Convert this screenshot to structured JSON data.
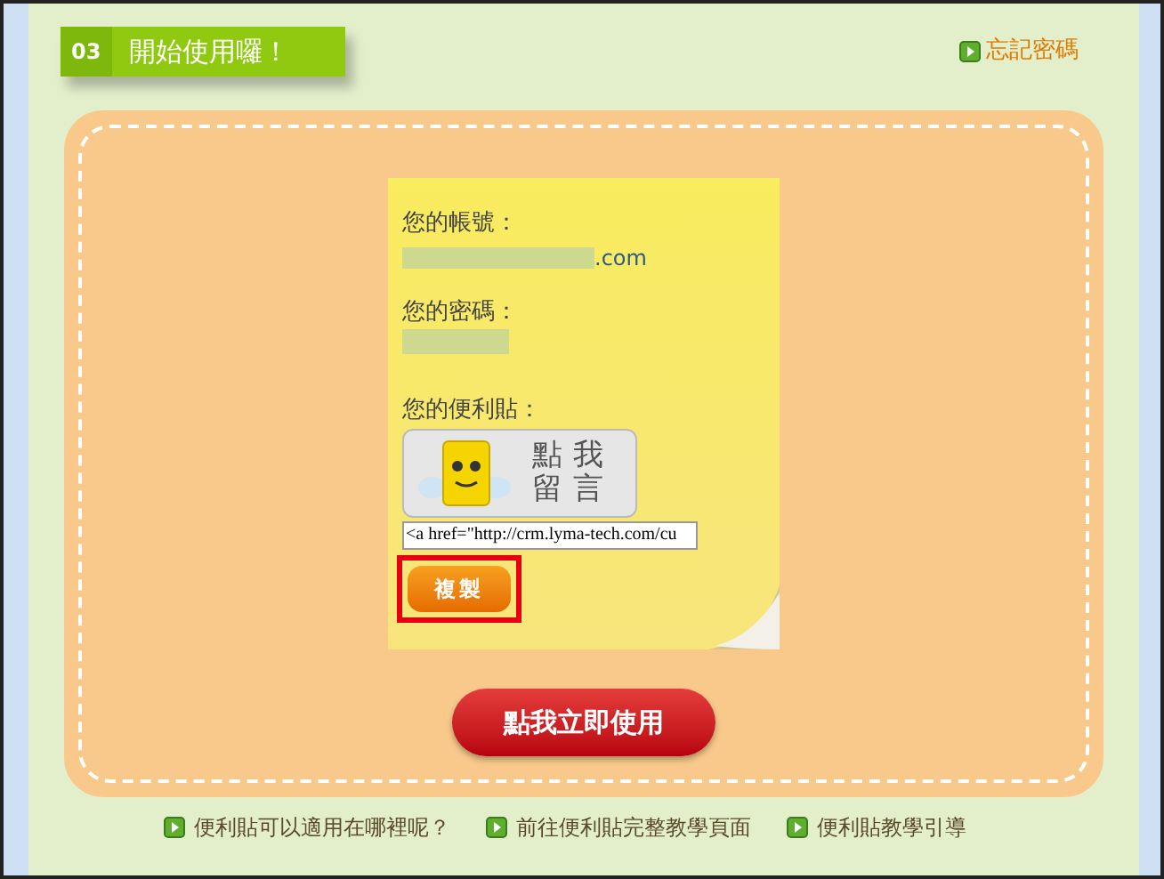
{
  "header": {
    "step": "03",
    "title": "開始使用囉！",
    "forgot_link": "忘記密碼"
  },
  "note": {
    "account_label": "您的帳號：",
    "account_suffix": ".com",
    "password_label": "您的密碼：",
    "sticker_label": "您的便利貼：",
    "sticker_text": "點我留言",
    "code_value": "<a href=\"http://crm.lyma-tech.com/cu",
    "copy_button": "複製"
  },
  "start_button": "點我立即使用",
  "footer_links": [
    "便利貼可以適用在哪裡呢？",
    "前往便利貼完整教學頁面",
    "便利貼教學引導"
  ]
}
